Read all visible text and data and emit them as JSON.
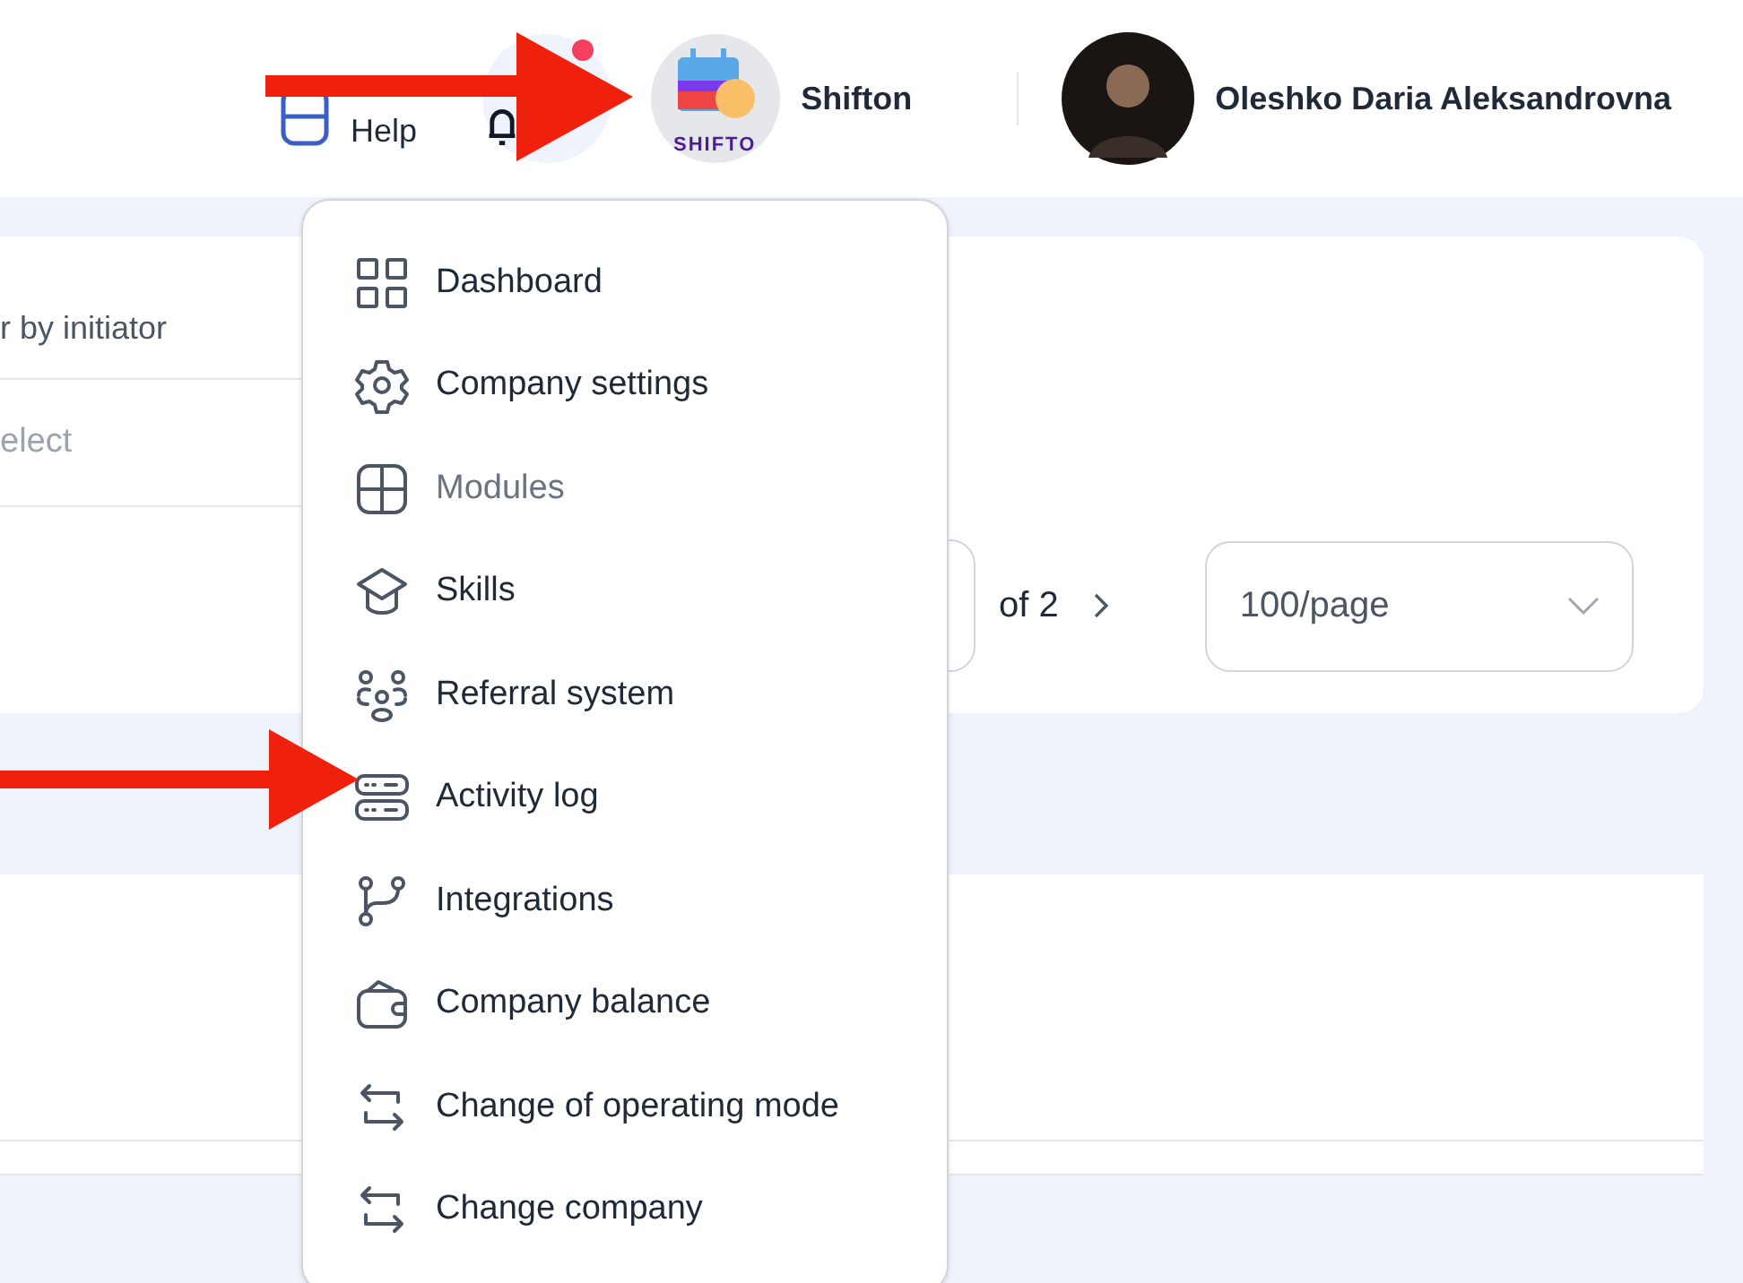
{
  "header": {
    "help": "Help",
    "notification_dot": true,
    "company": {
      "name": "Shifton",
      "logo_text": "SHIFTO"
    },
    "user": {
      "name": "Oleshko Daria Aleksandrovna"
    }
  },
  "filter": {
    "label": "r by initiator",
    "placeholder": "elect"
  },
  "pagination": {
    "of_text": "of 2",
    "page_size": "100/page"
  },
  "menu": [
    {
      "kind": "dashboard",
      "label": "Dashboard",
      "disabled": false
    },
    {
      "kind": "settings",
      "label": "Company settings",
      "disabled": false
    },
    {
      "kind": "modules",
      "label": "Modules",
      "disabled": true
    },
    {
      "kind": "skills",
      "label": "Skills",
      "disabled": false
    },
    {
      "kind": "referral",
      "label": "Referral system",
      "disabled": false
    },
    {
      "kind": "log",
      "label": "Activity log",
      "disabled": false
    },
    {
      "kind": "integrations",
      "label": "Integrations",
      "disabled": false
    },
    {
      "kind": "wallet",
      "label": "Company balance",
      "disabled": false
    },
    {
      "kind": "switch",
      "label": "Change of operating mode",
      "disabled": false
    },
    {
      "kind": "switch",
      "label": "Change company",
      "disabled": false
    }
  ]
}
